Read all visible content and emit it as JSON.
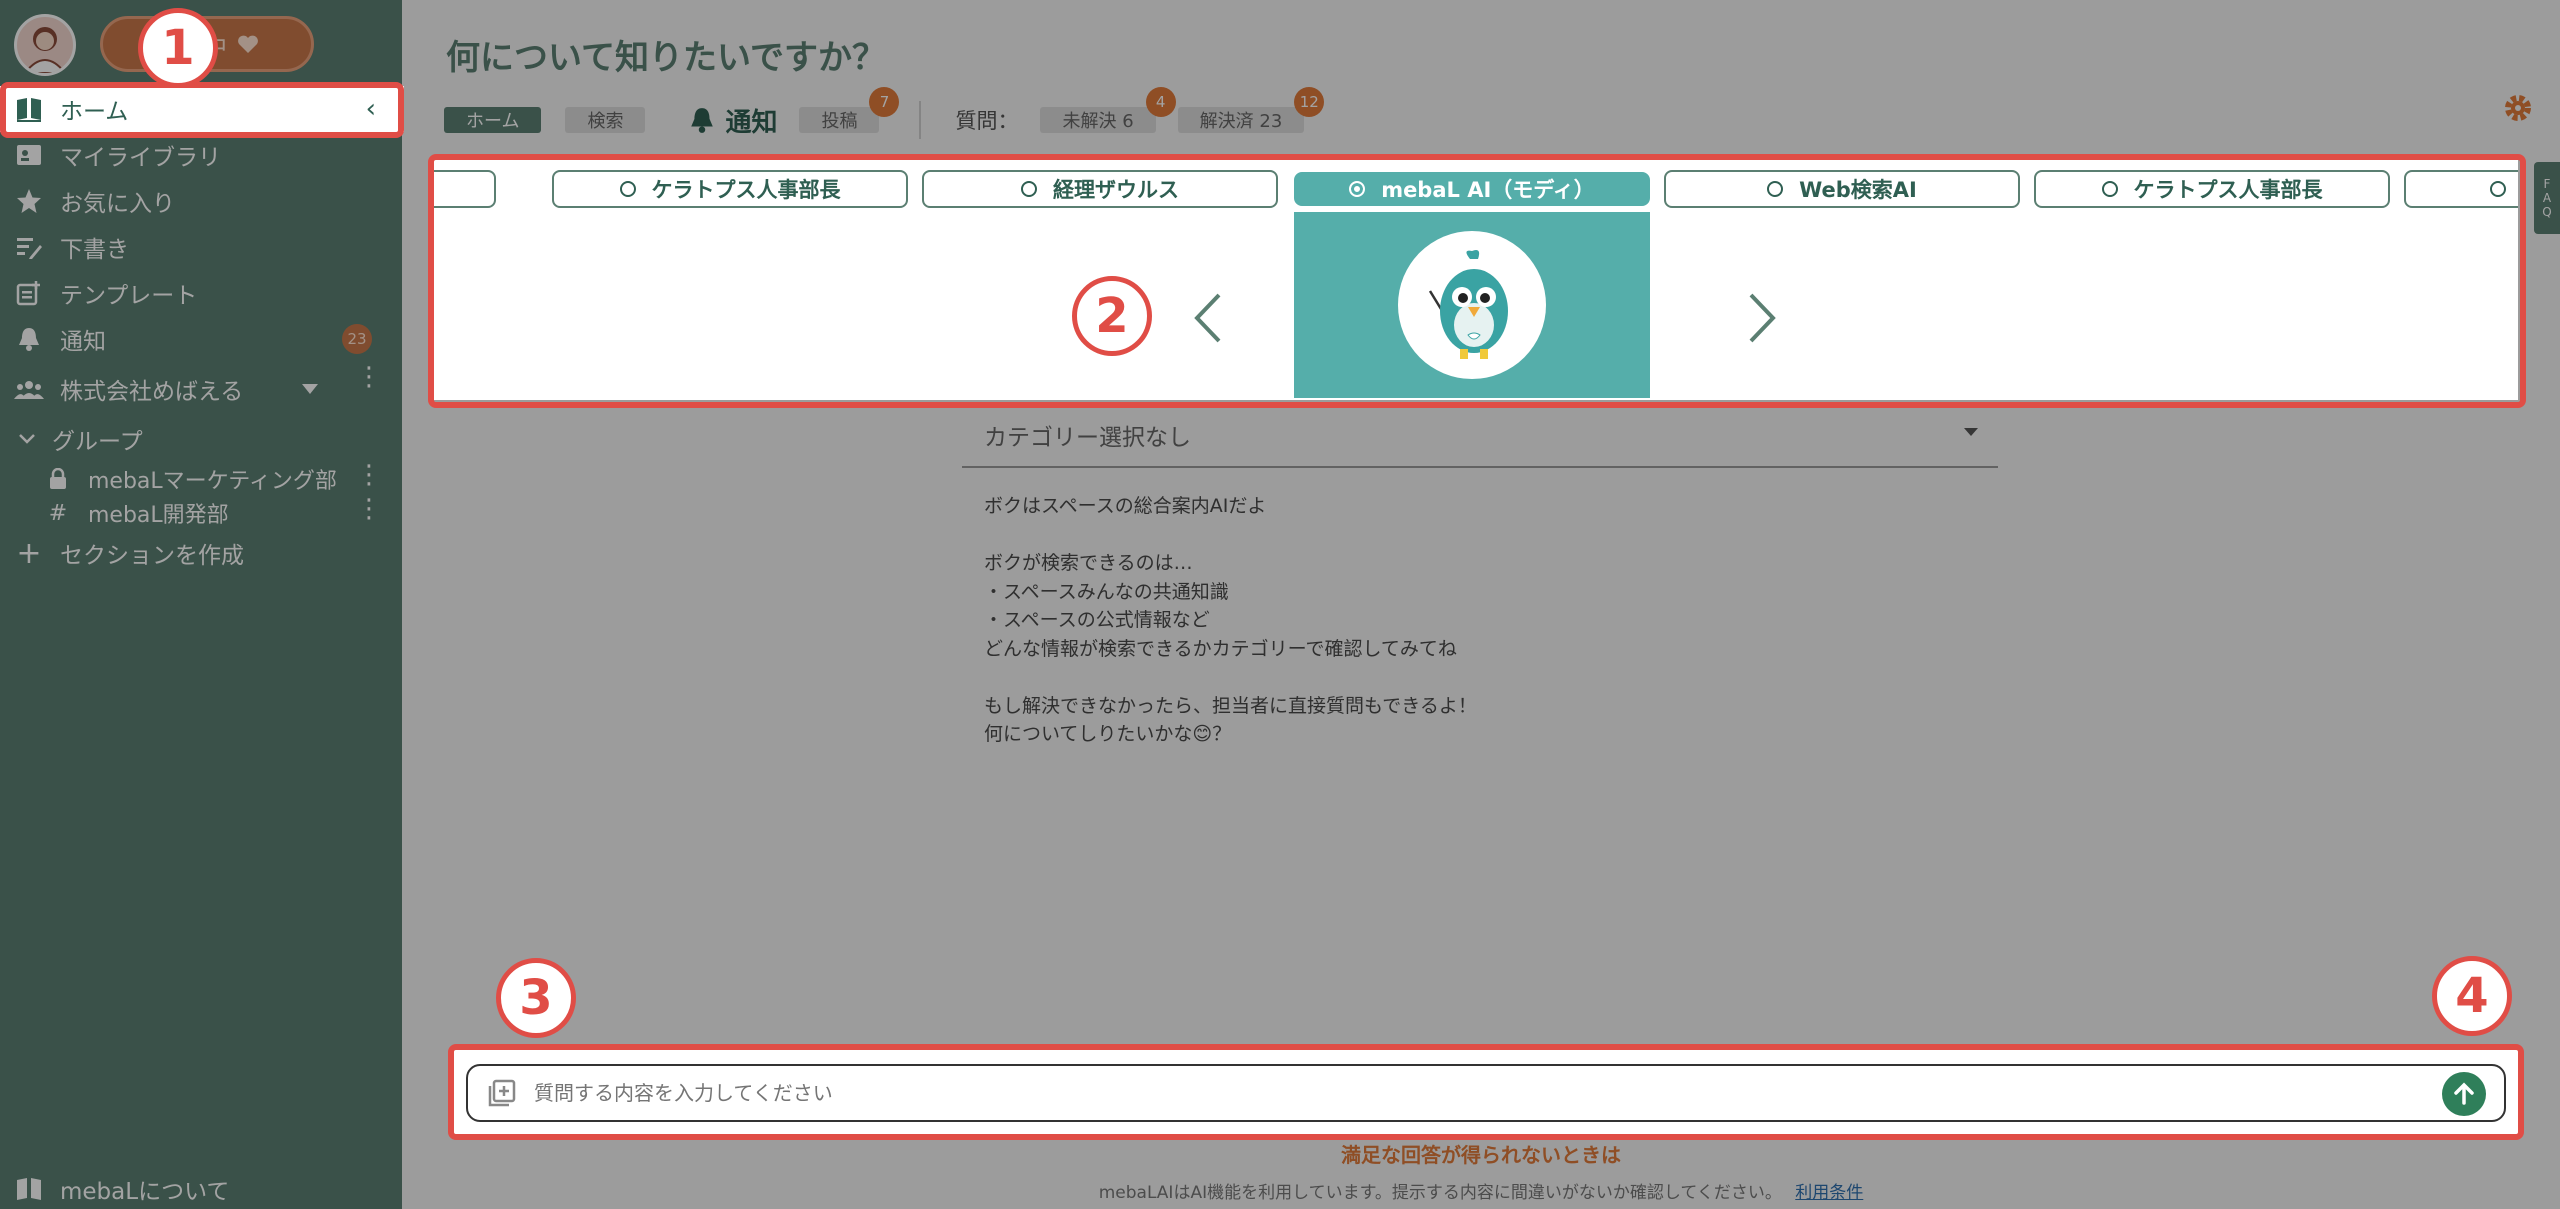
{
  "sidebar": {
    "trial_button": "体験中",
    "nav": [
      {
        "label": "ホーム"
      },
      {
        "label": "マイライブラリ"
      },
      {
        "label": "お気に入り"
      },
      {
        "label": "下書き"
      },
      {
        "label": "テンプレート"
      },
      {
        "label": "通知",
        "badge": "23"
      }
    ],
    "org": "株式会社めばえる",
    "group_header": "グループ",
    "groups": [
      "mebaLマーケティング部",
      "mebaL開発部"
    ],
    "create_section": "セクションを作成",
    "about": "mebaLについて"
  },
  "main": {
    "title": "何について知りたいですか？",
    "tabs": {
      "home": "ホーム",
      "search": "検索",
      "notification": "通知",
      "post": "投稿",
      "post_badge": "7",
      "question_label": "質問：",
      "unsolved": "未解決 6",
      "unsolved_badge": "4",
      "solved": "解決済 23",
      "solved_badge": "12"
    },
    "carousel": {
      "assistants": [
        "ケラトプス人事部長",
        "経理ザウルス",
        "mebaL AI（モディ）",
        "Web検索AI",
        "ケラトプス人事部長"
      ],
      "selected": "mebaL AI（モディ）"
    },
    "category": "カテゴリー選択なし",
    "intro": "ボクはスペースの総合案内AIだよ\n\nボクが検索できるのは…\n・スペースみんなの共通知識\n・スペースの公式情報など\nどんな情報が検索できるかカテゴリーで確認してみてね\n\nもし解決できなかったら、担当者に直接質問もできるよ！\n何についてしりたいかな😊？",
    "input_placeholder": "質問する内容を入力してください",
    "warning_link": "満足な回答が得られないときは",
    "footer": "mebaLAIはAI機能を利用しています。提示する内容に間違いがないか確認してください。",
    "terms": "利用条件",
    "faq": [
      "F",
      "A",
      "Q"
    ]
  },
  "annotations": [
    "1",
    "2",
    "3",
    "4"
  ],
  "colors": {
    "sidebar": "#5b7f72",
    "teal": "#55aeaa",
    "accent": "#e07a3a",
    "highlight": "#e04d46"
  }
}
